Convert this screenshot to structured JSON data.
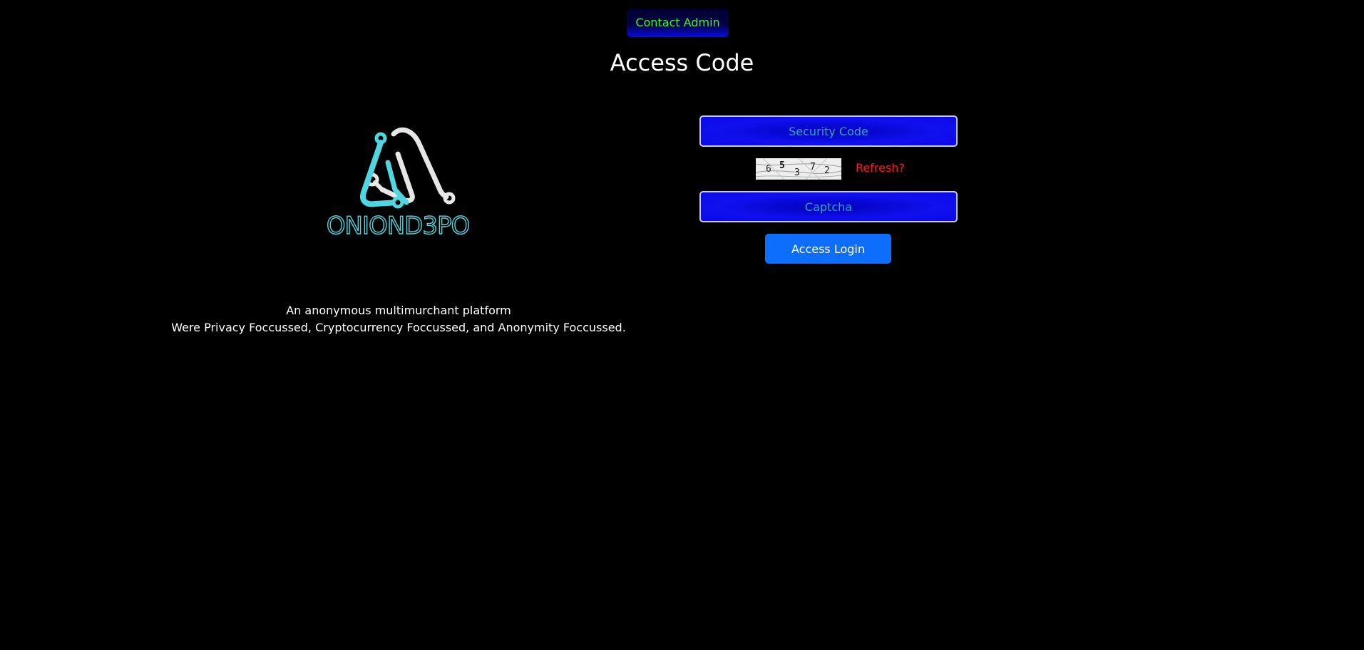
{
  "header": {
    "contact_label": "Contact Admin",
    "title": "Access Code"
  },
  "logo": {
    "brand_text": "ONIOND3PO",
    "icon": "onion-d3po-logo"
  },
  "tagline": {
    "line1": "An anonymous multimurchant platform",
    "line2": "Were Privacy Foccussed, Cryptocurrency Foccussed, and Anonymity Foccussed."
  },
  "form": {
    "security_placeholder": "Security Code",
    "captcha_placeholder": "Captcha",
    "captcha_digits": [
      "6",
      "5",
      "3",
      "7",
      "2"
    ],
    "refresh_label": "Refresh?",
    "login_label": "Access Login"
  },
  "colors": {
    "background": "#000000",
    "contact_text": "#2bff2b",
    "refresh_text": "#ff1a1a",
    "login_button": "#0d6efd",
    "logo_cyan": "#4fd6e0",
    "logo_white": "#e6e6e6"
  }
}
